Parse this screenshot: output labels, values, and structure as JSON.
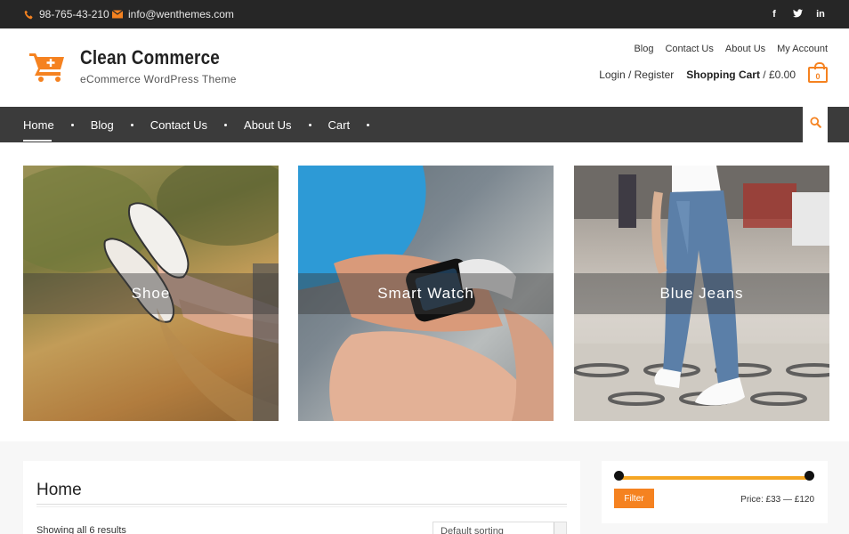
{
  "topbar": {
    "phone": "98-765-43-210",
    "email": "info@wenthemes.com",
    "social": [
      {
        "icon": "facebook-icon",
        "glyph": "f"
      },
      {
        "icon": "twitter-icon",
        "glyph": "t"
      },
      {
        "icon": "linkedin-icon",
        "glyph": "in"
      }
    ]
  },
  "header": {
    "site_title": "Clean Commerce",
    "site_description": "eCommerce WordPress Theme",
    "top_links": [
      "Blog",
      "Contact Us",
      "About Us",
      "My Account"
    ],
    "login_label": "Login / Register",
    "cart_label": "Shopping Cart",
    "cart_total": " / £0.00",
    "cart_count": "0"
  },
  "nav": {
    "items": [
      "Home",
      "Blog",
      "Contact Us",
      "About Us",
      "Cart"
    ],
    "active": "Home"
  },
  "featured": [
    {
      "label": "Shoe"
    },
    {
      "label": "Smart Watch"
    },
    {
      "label": "Blue Jeans"
    }
  ],
  "main": {
    "page_title": "Home",
    "result_count": "Showing all 6 results",
    "ordering_value": "Default sorting"
  },
  "sidebar": {
    "filter_label": "Filter",
    "price_range": "Price: £33 — £120"
  },
  "colors": {
    "accent": "#f58220",
    "topbar_bg": "#262626",
    "nav_bg": "#3b3b3b"
  }
}
